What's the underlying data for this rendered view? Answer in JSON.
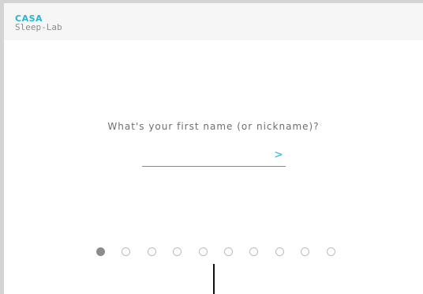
{
  "app": {
    "logo_line1": "CASA",
    "logo_line2": "Sleep-Lab",
    "accent_color": "#2ab3d4"
  },
  "question": {
    "text": "What's your first name (or nickname)?",
    "input_value": "",
    "input_placeholder": "",
    "next_icon": "chevron-right-icon",
    "next_glyph": ">"
  },
  "progress": {
    "total_steps": 10,
    "current_step": 1
  }
}
